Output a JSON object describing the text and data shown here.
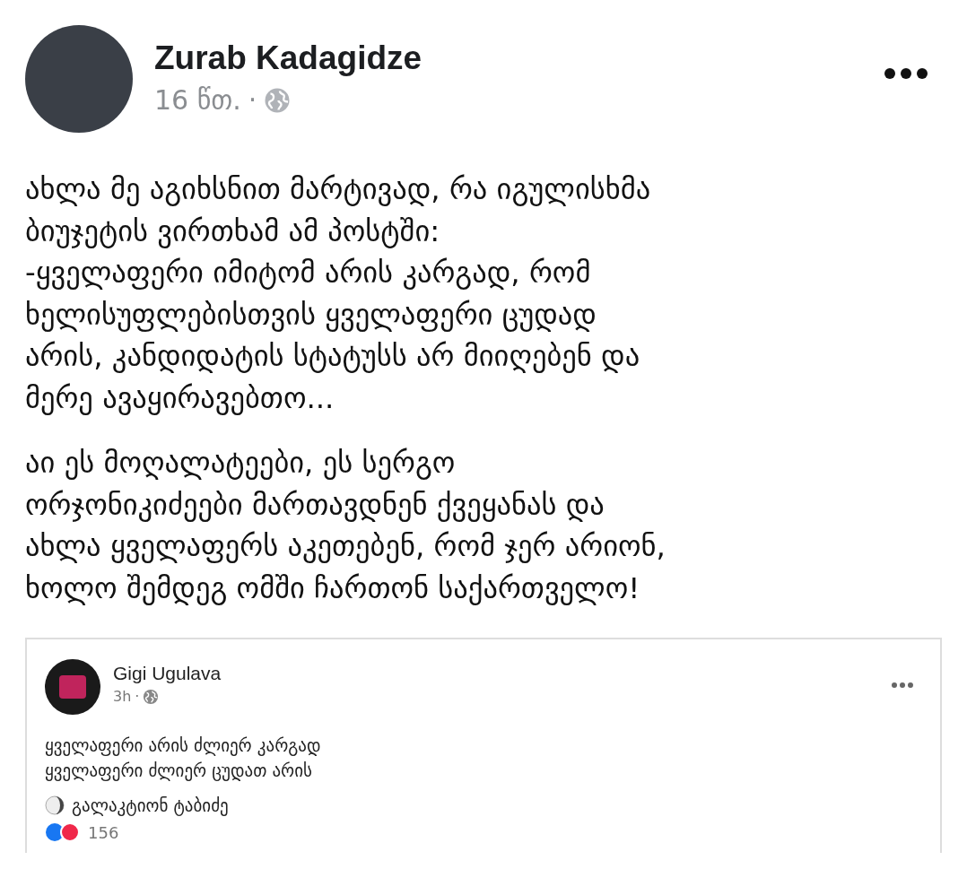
{
  "post": {
    "author": "Zurab Kadagidze",
    "time": "16 წთ.",
    "separator": "·",
    "paragraphs": [
      {
        "lines": [
          "ახლა მე აგიხსნით მარტივად, რა იგულისხმა",
          "ბიუჯეტის ვირთხამ ამ პოსტში:",
          "-ყველაფერი იმიტომ არის კარგად, რომ",
          "ხელისუფლებისთვის ყველაფერი ცუდად",
          "არის, კანდიდატის სტატუსს არ მიიღებენ და",
          "მერე ავაყირავებთო..."
        ]
      },
      {
        "lines": [
          "აი ეს მოღალატეები, ეს სერგო",
          "ორჯონიკიძეები მართავდნენ ქვეყანას და",
          "ახლა ყველაფერს აკეთებენ, რომ ჯერ არიონ,",
          "ხოლო შემდეგ ომში ჩართონ საქართველო!"
        ]
      }
    ]
  },
  "shared_post": {
    "author": "Gigi Ugulava",
    "time": "3h",
    "separator": "·",
    "lines": [
      "ყველაფერი არის ძლიერ კარგად",
      "ყველაფერი ძლიერ ცუდათ არის"
    ],
    "signature": "გალაკტიონ ტაბიძე",
    "reaction_count": "156"
  }
}
